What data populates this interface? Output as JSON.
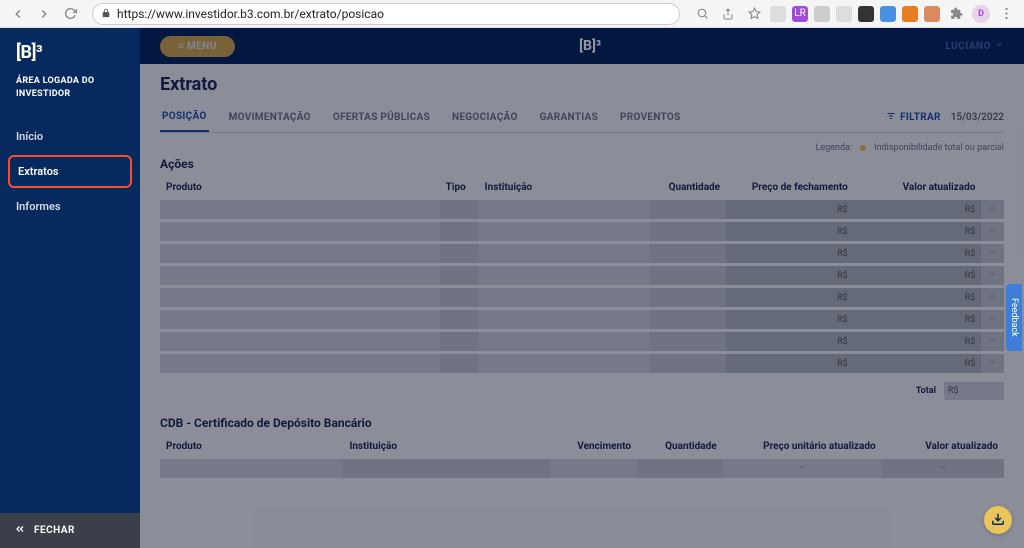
{
  "browser": {
    "url": "https://www.investidor.b3.com.br/extrato/posicao"
  },
  "sidebar": {
    "logo_text": "[B]³",
    "subtitle": "ÁREA LOGADA DO INVESTIDOR",
    "items": [
      {
        "label": "Início"
      },
      {
        "label": "Extratos"
      },
      {
        "label": "Informes"
      }
    ],
    "footer": "FECHAR"
  },
  "topbar": {
    "menu_label": "≡ MENU",
    "center_logo": "[B]³",
    "user": "LUCIANO"
  },
  "page": {
    "title": "Extrato",
    "tabs": [
      {
        "label": "POSIÇÃO"
      },
      {
        "label": "MOVIMENTAÇÃO"
      },
      {
        "label": "OFERTAS PÚBLICAS"
      },
      {
        "label": "NEGOCIAÇÃO"
      },
      {
        "label": "GARANTIAS"
      },
      {
        "label": "PROVENTOS"
      }
    ],
    "filter_label": "FILTRAR",
    "date": "15/03/2022",
    "legend": {
      "title": "Legenda:",
      "text": "Indisponibilidade total ou parcial"
    },
    "sections": {
      "acoes": {
        "title": "Ações",
        "headers": {
          "produto": "Produto",
          "tipo": "Tipo",
          "instituicao": "Instituição",
          "quantidade": "Quantidade",
          "preco": "Preço de fechamento",
          "valor": "Valor atualizado"
        },
        "currency": "R$",
        "row_count": 8,
        "total_label": "Total",
        "total_currency": "R$"
      },
      "cdb": {
        "title": "CDB - Certificado de Depósito Bancário",
        "headers": {
          "produto": "Produto",
          "instituicao": "Instituição",
          "vencimento": "Vencimento",
          "quantidade": "Quantidade",
          "preco": "Preço unitário atualizado",
          "valor": "Valor atualizado"
        },
        "row_count": 1
      }
    }
  },
  "feedback_label": "Feedback"
}
